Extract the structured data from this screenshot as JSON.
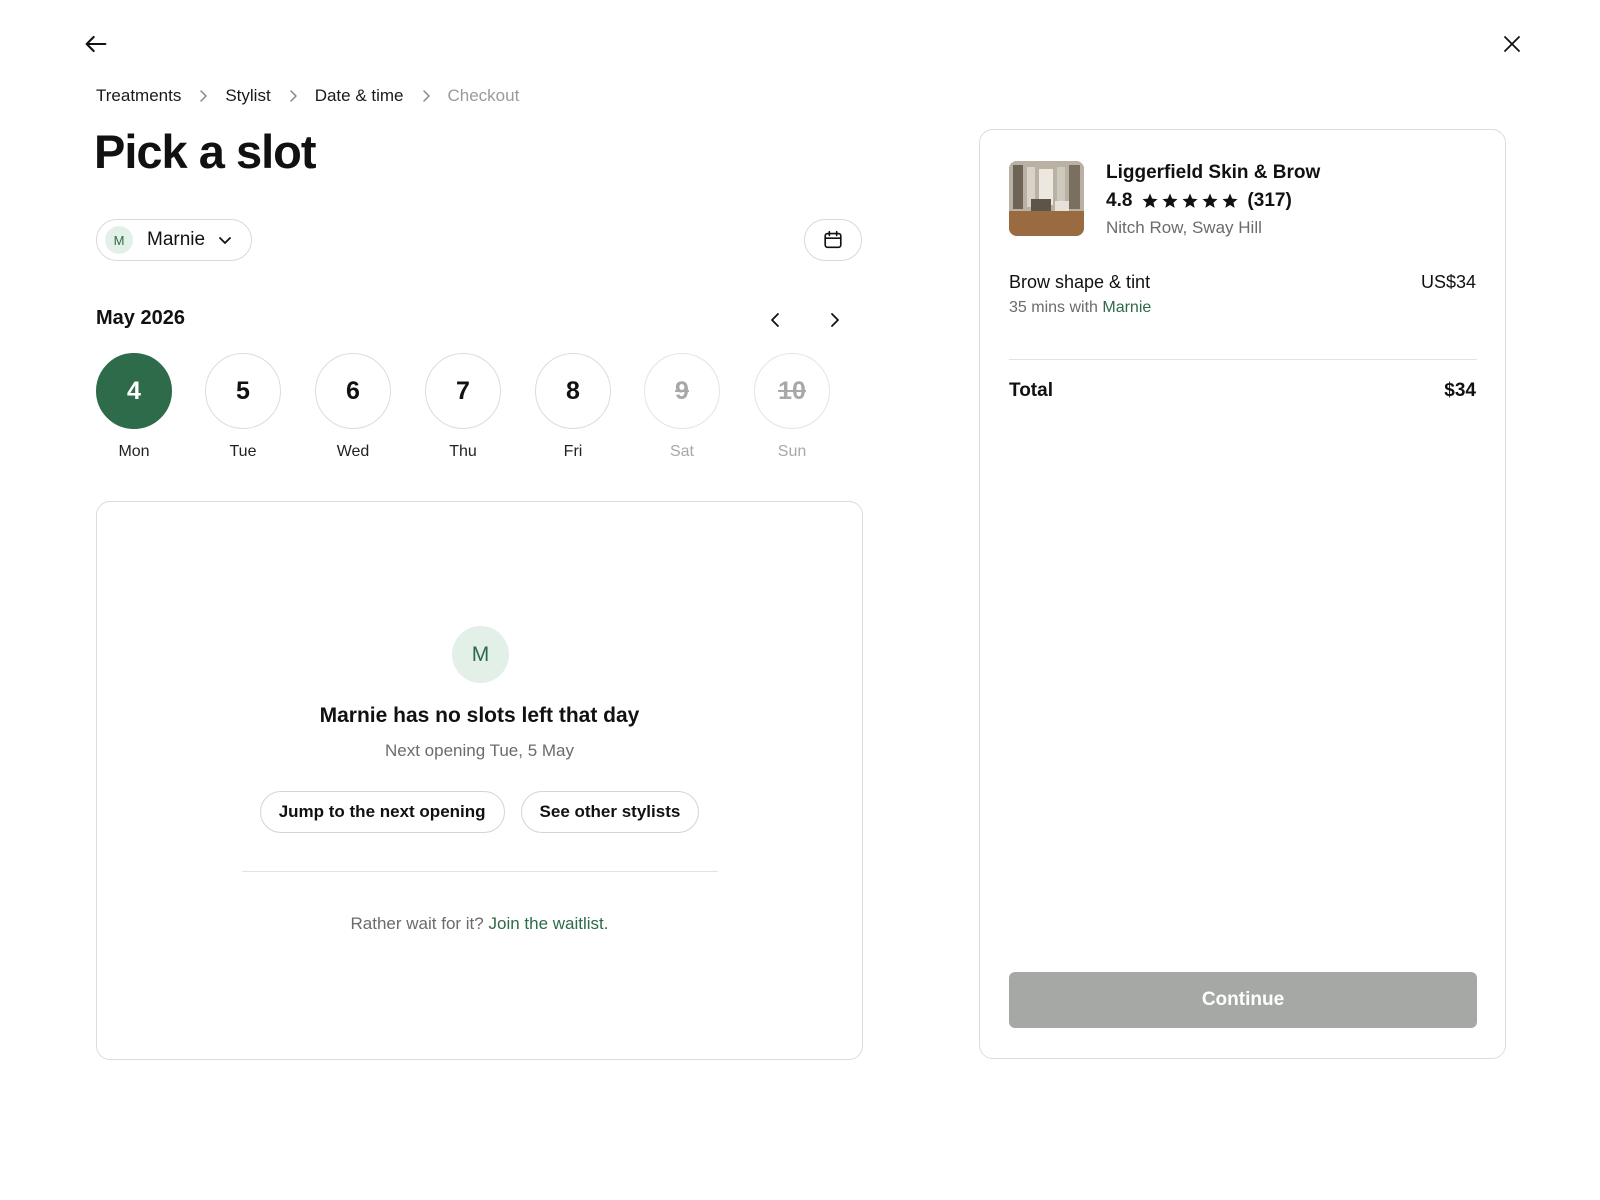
{
  "icons": {
    "back": "arrow-left-icon",
    "close": "close-icon",
    "breadcrumb_separator": "chevron-right-icon",
    "stylist_dropdown": "chevron-down-icon",
    "calendar": "calendar-icon",
    "month_prev": "chevron-left-icon",
    "month_next": "chevron-right-icon",
    "rating": "star-icon"
  },
  "colors": {
    "accent_green": "#2e6b4a",
    "avatar_bg": "#e3f0e7",
    "muted_text": "#6b6b6b",
    "disabled_button": "#a6a8a6"
  },
  "breadcrumb": [
    "Treatments",
    "Stylist",
    "Date & time",
    "Checkout"
  ],
  "page_title": "Pick a slot",
  "stylist": {
    "initial": "M",
    "name": "Marnie"
  },
  "month": "May 2026",
  "days": [
    {
      "num": "4",
      "label": "Mon",
      "state": "selected"
    },
    {
      "num": "5",
      "label": "Tue",
      "state": "available"
    },
    {
      "num": "6",
      "label": "Wed",
      "state": "available"
    },
    {
      "num": "7",
      "label": "Thu",
      "state": "available"
    },
    {
      "num": "8",
      "label": "Fri",
      "state": "available"
    },
    {
      "num": "9",
      "label": "Sat",
      "state": "unavailable"
    },
    {
      "num": "10",
      "label": "Sun",
      "state": "unavailable"
    }
  ],
  "empty_state": {
    "initial": "M",
    "title": "Marnie has no slots left that day",
    "subtitle": "Next opening Tue, 5 May",
    "primary_action": "Jump to the next opening",
    "secondary_action": "See other stylists",
    "waitlist_prefix": "Rather wait for it?",
    "waitlist_link": "Join the waitlist."
  },
  "summary": {
    "business_name": "Liggerfield Skin & Brow",
    "rating": "4.8",
    "stars": 5,
    "reviews": "(317)",
    "address": "Nitch Row, Sway Hill",
    "service_name": "Brow shape & tint",
    "service_price": "US$34",
    "service_duration": "35 mins with",
    "service_stylist": "Marnie",
    "total_label": "Total",
    "total_value": "$34",
    "continue_label": "Continue"
  }
}
